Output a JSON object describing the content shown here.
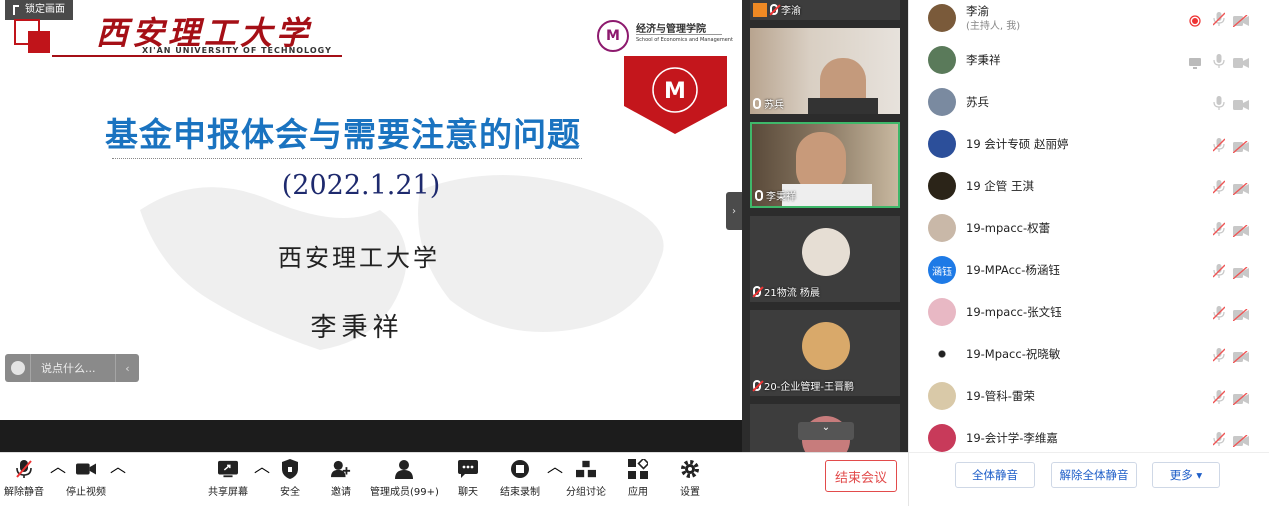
{
  "slide": {
    "lock_label": "锁定画面",
    "university_cn": "西安理工大学",
    "university_en": "XI'AN UNIVERSITY OF TECHNOLOGY",
    "school_cn": "经济与管理学院",
    "school_en": "School of Economics and Management",
    "title": "基金申报体会与需要注意的问题",
    "date": "(2022.1.21)",
    "organization": "西安理工大学",
    "author": "李秉祥"
  },
  "chat_input": {
    "placeholder": "说点什么..."
  },
  "video_strip": [
    {
      "name": "李渝",
      "muted": true
    },
    {
      "name": "苏兵",
      "muted": false
    },
    {
      "name": "李秉祥",
      "muted": false,
      "active": true
    },
    {
      "name": "21物流 杨晨",
      "muted": true
    },
    {
      "name": "20-企业管理-王晋鹏",
      "muted": true
    },
    {
      "name": "",
      "muted": true
    }
  ],
  "toolbar": {
    "unmute": "解除静音",
    "stop_video": "停止视频",
    "share_screen": "共享屏幕",
    "security": "安全",
    "invite": "邀请",
    "manage_members": "管理成员(99+)",
    "chat": "聊天",
    "stop_recording": "结束录制",
    "breakout": "分组讨论",
    "apps": "应用",
    "settings": "设置",
    "end_meeting": "结束会议"
  },
  "participants": [
    {
      "name": "李渝",
      "sub": "(主持人, 我)",
      "color": "#7a5a3a"
    },
    {
      "name": "李秉祥",
      "color": "#5a7a5a"
    },
    {
      "name": "苏兵",
      "color": "#7a8aa0"
    },
    {
      "name": "19 会计专硕 赵丽婷",
      "color": "#2c4f9a"
    },
    {
      "name": "19 企管 王淇",
      "color": "#2b2418"
    },
    {
      "name": "19-mpacc-权蕾",
      "color": "#c9b8a8"
    },
    {
      "name": "19-MPAcc-杨涵钰",
      "avatar_text": "涵钰",
      "color": "#1e7ae6"
    },
    {
      "name": "19-mpacc-张文钰",
      "color": "#e8b8c4"
    },
    {
      "name": "19-Mpacc-祝晓敏",
      "color": "#ffffff"
    },
    {
      "name": "19-管科-雷荣",
      "color": "#d9c9a8"
    },
    {
      "name": "19-会计学-李维嘉",
      "color": "#c83a5a"
    }
  ],
  "panel_footer": {
    "mute_all": "全体静音",
    "unmute_all": "解除全体静音",
    "more": "更多 ▾"
  }
}
